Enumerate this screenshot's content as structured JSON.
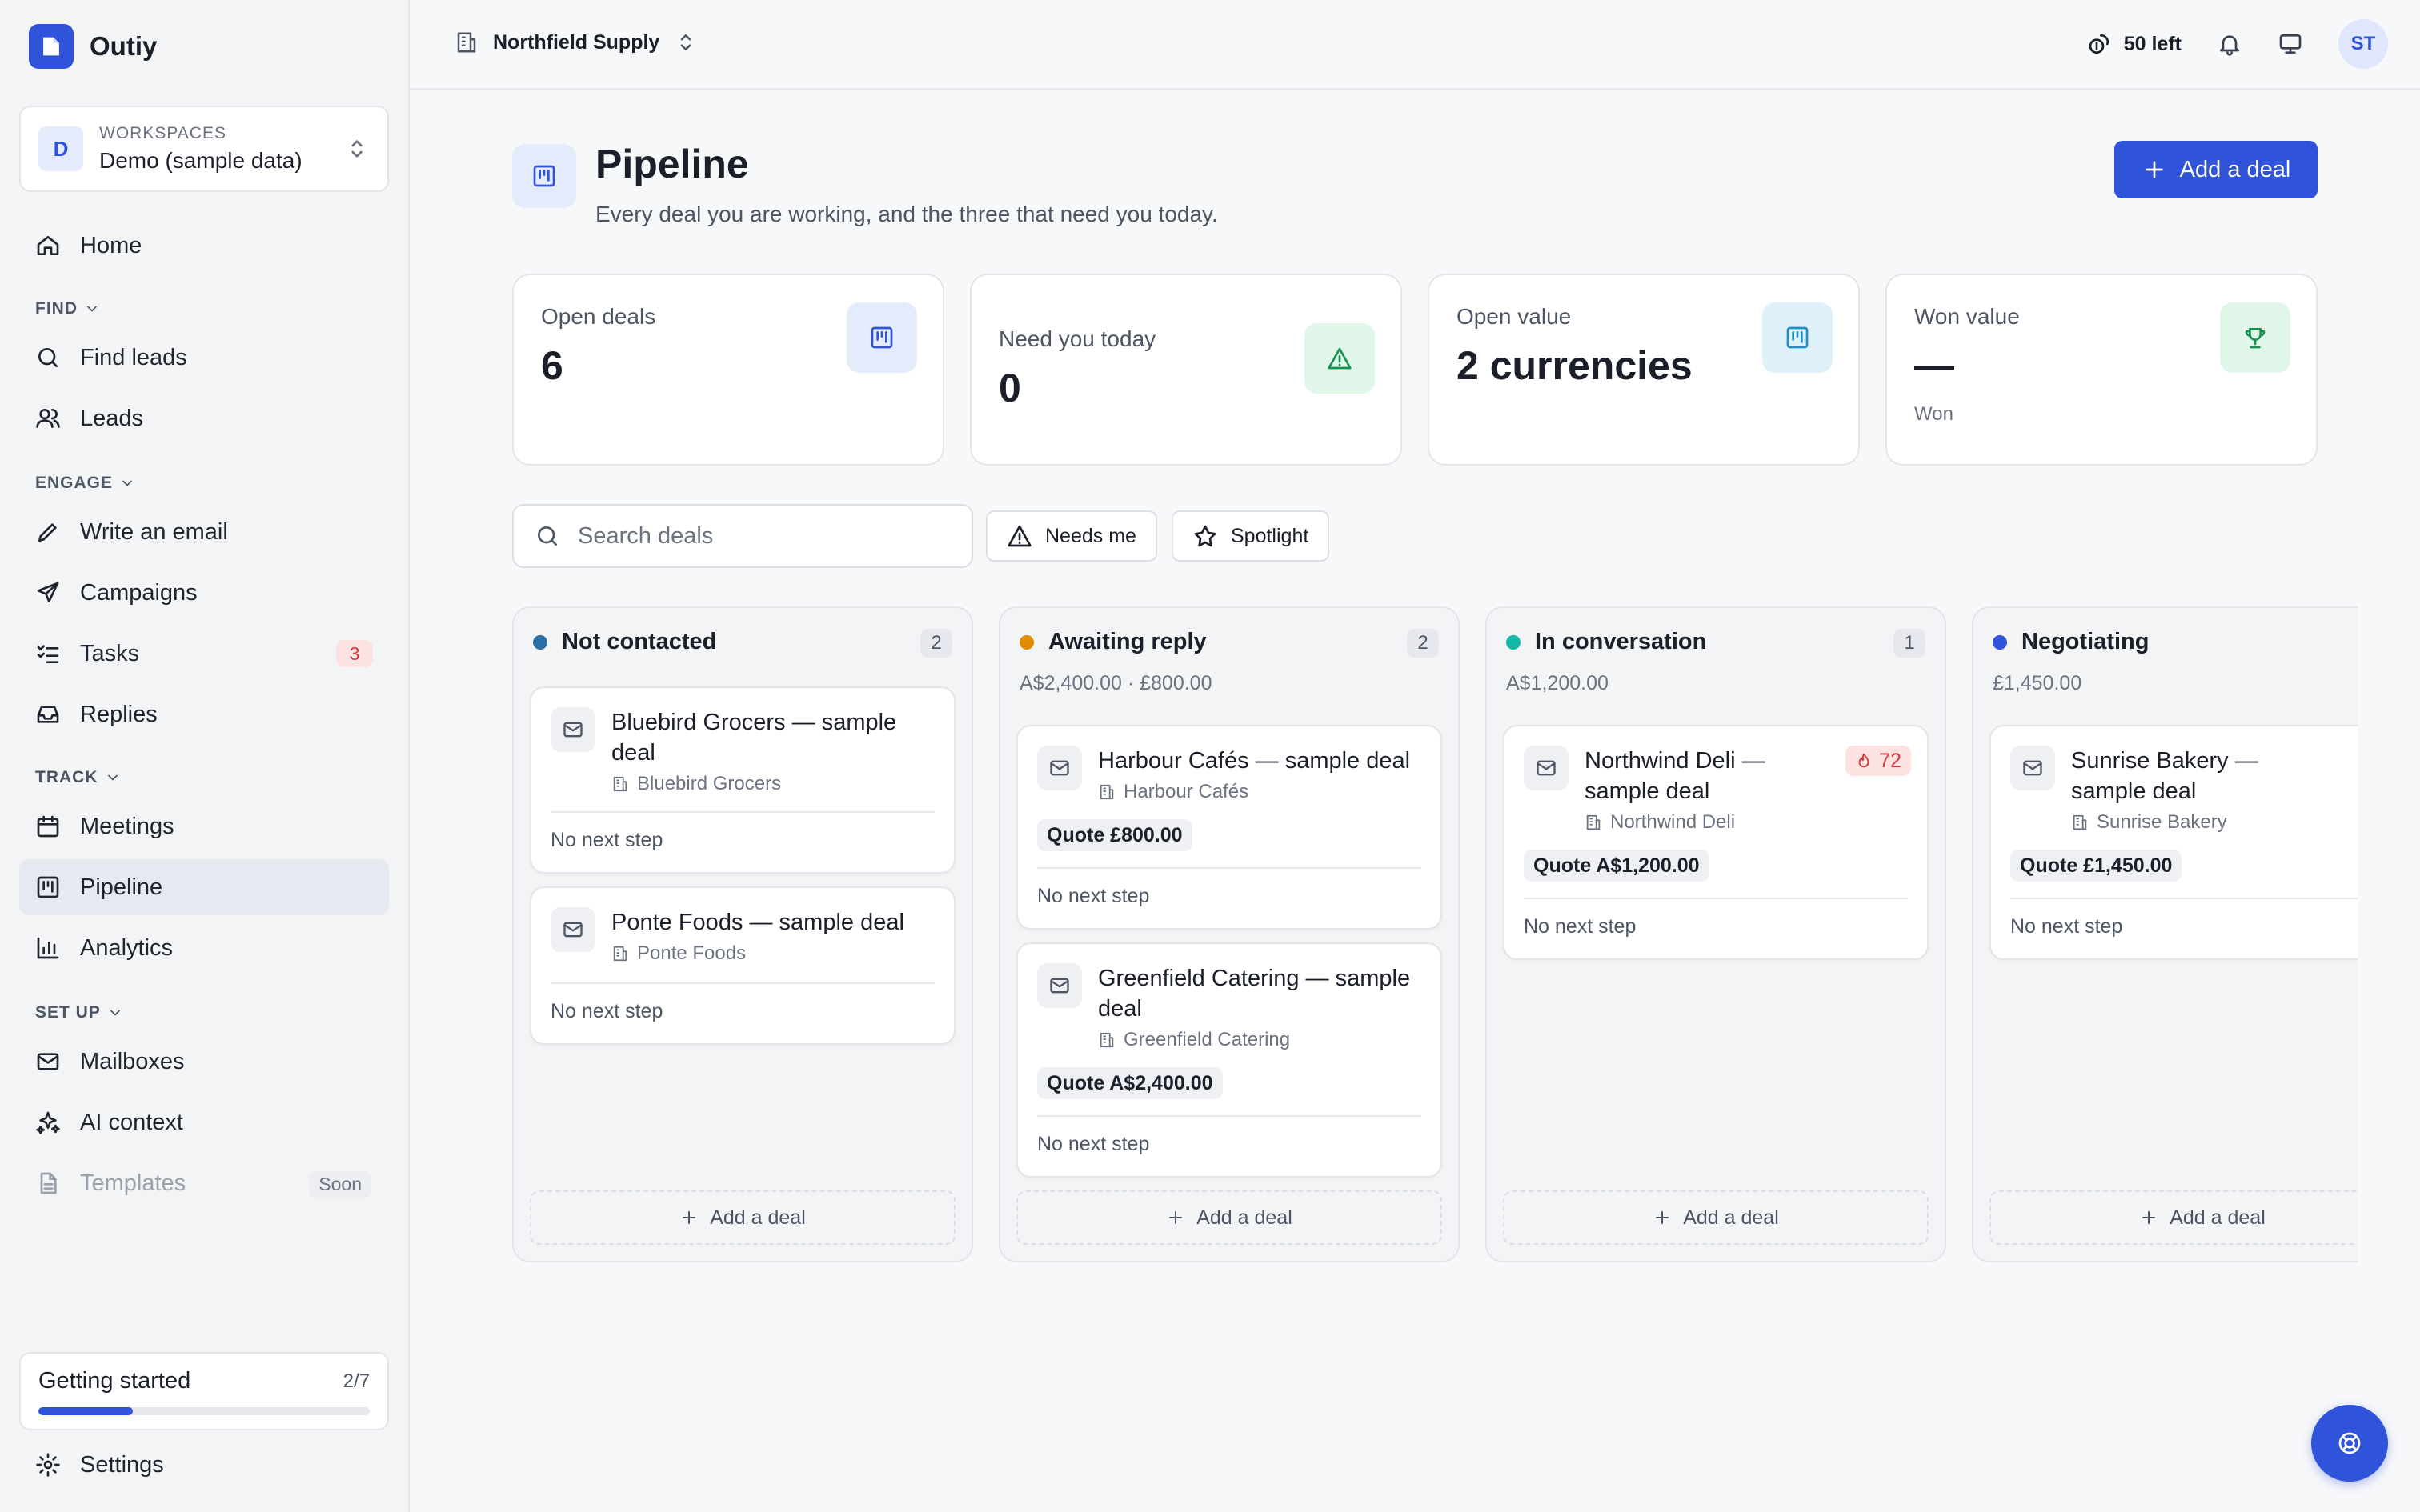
{
  "app": {
    "name": "Outiy"
  },
  "workspace": {
    "label": "WORKSPACES",
    "initial": "D",
    "name": "Demo (sample data)"
  },
  "sidebar": {
    "home": "Home",
    "sections": {
      "find": "FIND",
      "engage": "ENGAGE",
      "track": "TRACK",
      "setup": "SET UP"
    },
    "items": {
      "find_leads": "Find leads",
      "leads": "Leads",
      "write_email": "Write an email",
      "campaigns": "Campaigns",
      "tasks": "Tasks",
      "tasks_badge": "3",
      "replies": "Replies",
      "meetings": "Meetings",
      "pipeline": "Pipeline",
      "analytics": "Analytics",
      "mailboxes": "Mailboxes",
      "ai_context": "AI context",
      "templates": "Templates",
      "templates_badge": "Soon"
    },
    "getting_started": {
      "title": "Getting started",
      "count": "2/7",
      "progress": 0.2857
    },
    "settings": "Settings"
  },
  "topbar": {
    "org_name": "Northfield Supply",
    "credits": "50 left",
    "user_initials": "ST"
  },
  "page": {
    "title": "Pipeline",
    "subtitle": "Every deal you are working, and the three that need you today.",
    "add_deal": "Add a deal"
  },
  "stats": [
    {
      "label": "Open deals",
      "value": "6",
      "foot": "",
      "icon": "pipeline-icon"
    },
    {
      "label": "Need you today",
      "value": "0",
      "foot": "",
      "icon": "warning-icon"
    },
    {
      "label": "Open value",
      "value": "2 currencies",
      "foot": "",
      "icon": "pipeline-icon"
    },
    {
      "label": "Won value",
      "value": "—",
      "foot": "Won",
      "icon": "trophy-icon"
    }
  ],
  "filters": {
    "search_placeholder": "Search deals",
    "needs_me": "Needs me",
    "spotlight": "Spotlight"
  },
  "columns": [
    {
      "name": "Not contacted",
      "count": "2",
      "value": "",
      "color": "#2b6ea3",
      "cards": [
        {
          "title": "Bluebird Grocers — sample deal",
          "company": "Bluebird Grocers",
          "quote": "",
          "next": "No next step",
          "score": ""
        },
        {
          "title": "Ponte Foods — sample deal",
          "company": "Ponte Foods",
          "quote": "",
          "next": "No next step",
          "score": ""
        }
      ],
      "add": "Add a deal"
    },
    {
      "name": "Awaiting reply",
      "count": "2",
      "value": "A$2,400.00 · £800.00",
      "color": "#e08a00",
      "cards": [
        {
          "title": "Harbour Cafés — sample deal",
          "company": "Harbour Cafés",
          "quote": "Quote £800.00",
          "next": "No next step",
          "score": ""
        },
        {
          "title": "Greenfield Catering — sample deal",
          "company": "Greenfield Catering",
          "quote": "Quote A$2,400.00",
          "next": "No next step",
          "score": ""
        }
      ],
      "add": "Add a deal"
    },
    {
      "name": "In conversation",
      "count": "1",
      "value": "A$1,200.00",
      "color": "#14b8a6",
      "cards": [
        {
          "title": "Northwind Deli — sample deal",
          "company": "Northwind Deli",
          "quote": "Quote A$1,200.00",
          "next": "No next step",
          "score": "72"
        }
      ],
      "add": "Add a deal"
    },
    {
      "name": "Negotiating",
      "count": "",
      "value": "£1,450.00",
      "color": "#2f53d9",
      "cards": [
        {
          "title": "Sunrise Bakery — sample deal",
          "company": "Sunrise Bakery",
          "quote": "Quote £1,450.00",
          "next": "No next step",
          "score": ""
        }
      ],
      "add": "Add a deal"
    }
  ]
}
